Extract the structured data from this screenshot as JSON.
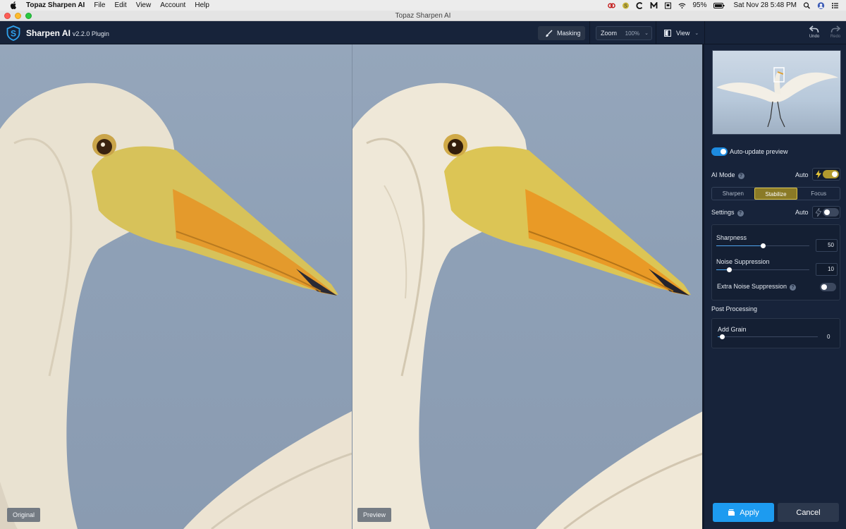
{
  "menubar": {
    "app_name": "Topaz Sharpen AI",
    "items": [
      "File",
      "Edit",
      "View",
      "Account",
      "Help"
    ],
    "battery": "95%",
    "datetime": "Sat Nov 28  5:48 PM"
  },
  "window": {
    "title": "Topaz Sharpen AI"
  },
  "toolbar": {
    "app_name": "Sharpen AI",
    "version": "v2.2.0 Plugin",
    "masking_label": "Masking",
    "zoom_label": "Zoom",
    "zoom_value": "100%",
    "view_label": "View",
    "undo_label": "Undo",
    "redo_label": "Redo"
  },
  "panes": {
    "original_label": "Original",
    "preview_label": "Preview"
  },
  "panel": {
    "auto_update_label": "Auto-update preview",
    "auto_update_on": true,
    "ai_mode_label": "AI Mode",
    "ai_mode_auto_label": "Auto",
    "ai_mode_auto_on": true,
    "modes": [
      "Sharpen",
      "Stabilize",
      "Focus"
    ],
    "active_mode": "Stabilize",
    "settings_label": "Settings",
    "settings_auto_label": "Auto",
    "settings_auto_on": false,
    "sharpness_label": "Sharpness",
    "sharpness_value": "50",
    "noise_label": "Noise Suppression",
    "noise_value": "10",
    "extra_noise_label": "Extra Noise Suppression",
    "extra_noise_on": false,
    "post_processing_label": "Post Processing",
    "add_grain_label": "Add Grain",
    "add_grain_value": "0",
    "apply_label": "Apply",
    "cancel_label": "Cancel"
  },
  "colors": {
    "accent_blue": "#1d9bf0",
    "active_mode_gold": "#8a7a26",
    "panel_bg": "#17233a"
  }
}
